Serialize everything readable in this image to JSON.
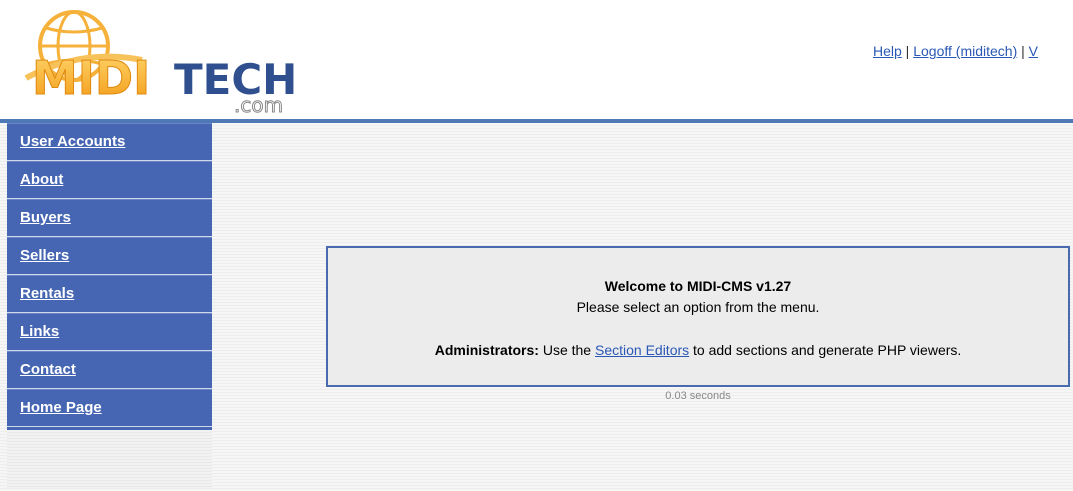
{
  "logo": {
    "text_main": "MIDITECH",
    "text_sub": ".com"
  },
  "top_links": {
    "help": "Help",
    "sep1": " | ",
    "logoff": "Logoff (miditech)",
    "sep2": " | ",
    "truncated": "V"
  },
  "sidebar": {
    "items": [
      {
        "label": "User Accounts"
      },
      {
        "label": "About"
      },
      {
        "label": "Buyers"
      },
      {
        "label": "Sellers"
      },
      {
        "label": "Rentals"
      },
      {
        "label": "Links"
      },
      {
        "label": "Contact"
      },
      {
        "label": "Home Page"
      }
    ]
  },
  "welcome": {
    "title": "Welcome to MIDI-CMS v1.27",
    "subtitle": "Please select an option from the menu.",
    "admin_label": "Administrators:",
    "admin_pre": " Use the ",
    "admin_link": "Section Editors",
    "admin_post": " to add sections and generate PHP viewers."
  },
  "timing": "0.03 seconds",
  "colors": {
    "sidebar_bg": "#4666b3",
    "divider": "#4f79b6",
    "link": "#2a58b5",
    "logo_orange": "#f5a623",
    "logo_blue": "#2f4f8f"
  }
}
